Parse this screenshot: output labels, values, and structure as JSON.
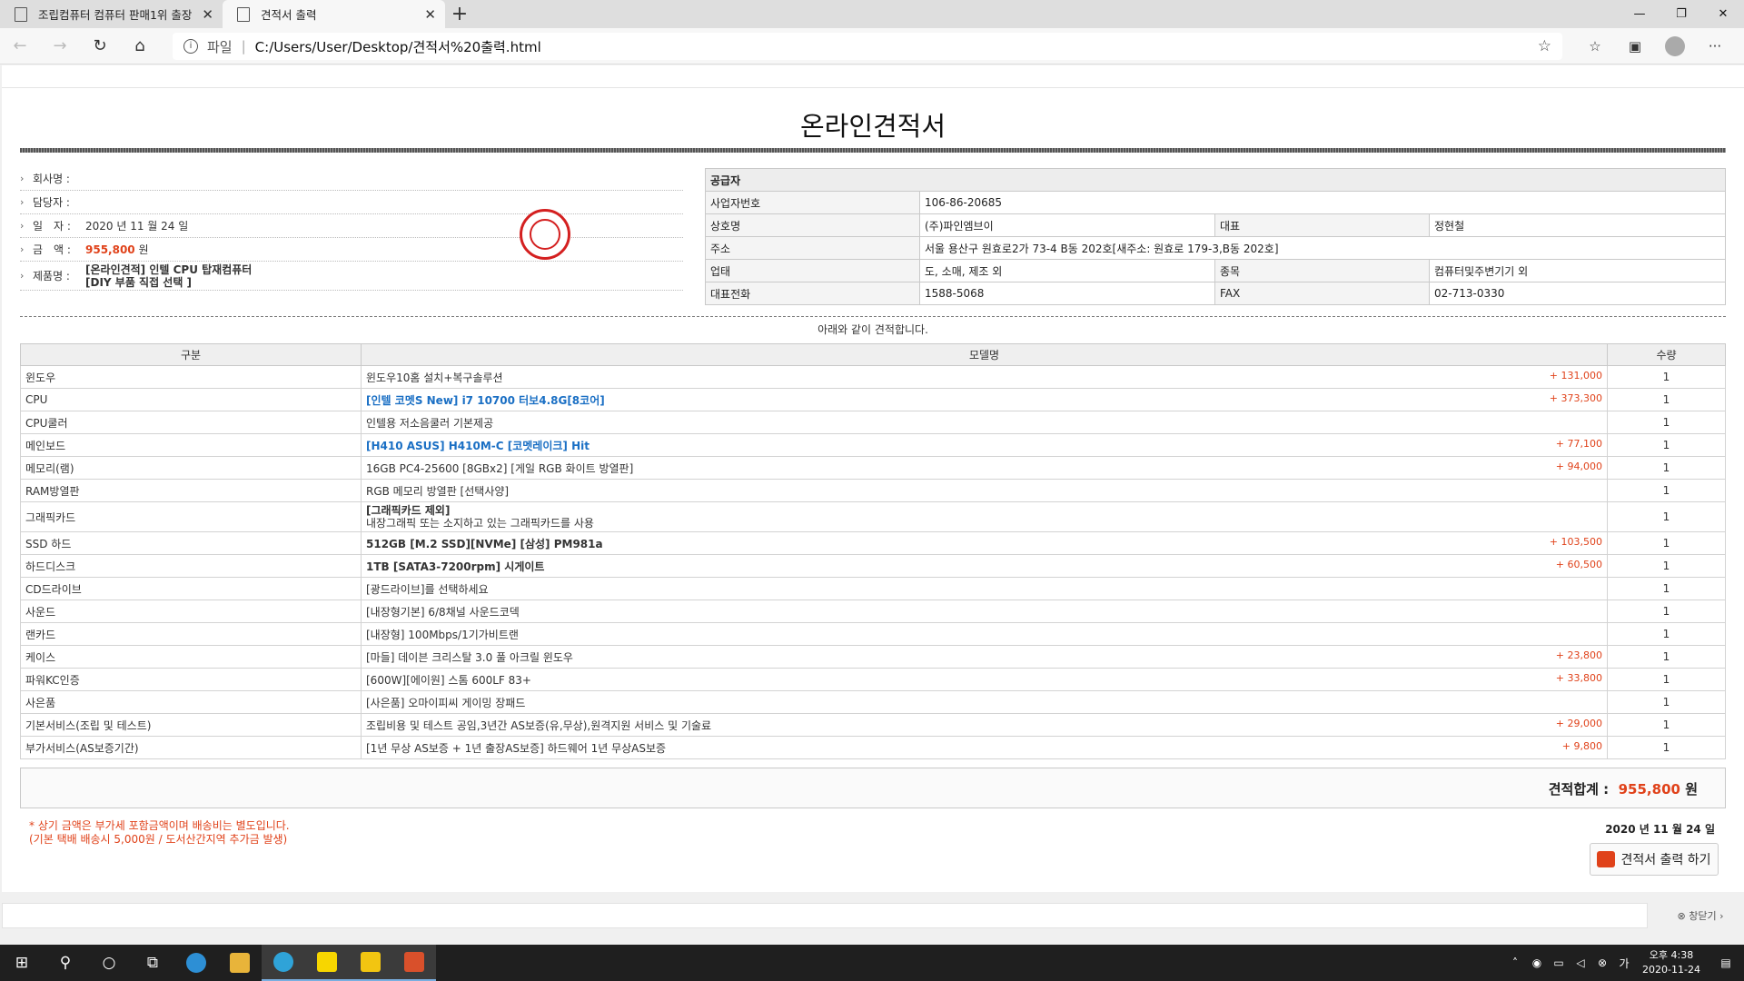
{
  "browser": {
    "tabs": [
      {
        "title": "조립컴퓨터 컴퓨터 판매1위 출장",
        "active": false
      },
      {
        "title": "견적서 출력",
        "active": true
      }
    ],
    "address_proto": "파일",
    "address_url": "C:/Users/User/Desktop/견적서%20출력.html"
  },
  "doc": {
    "title": "온라인견적서",
    "customer": {
      "company_label": "회사명 :",
      "contact_label": "담당자 :",
      "date_label": "일　자 :",
      "date_value": "2020 년 11 월 24 일",
      "amount_label": "금　액 :",
      "amount_value": "955,800",
      "amount_unit": "원",
      "product_label": "제품명 :",
      "product_line1": "[온라인견적] 인텔 CPU 탑재컴퓨터",
      "product_line2": "[DIY 부품 직접 선택 ]"
    },
    "supplier": {
      "header": "공급자",
      "reg_label": "사업자번호",
      "reg_value": "106-86-20685",
      "name_label": "상호명",
      "name_value": "(주)파인엠브이",
      "ceo_label": "대표",
      "ceo_value": "정현철",
      "addr_label": "주소",
      "addr_value": "서울 용산구 원효로2가 73-4 B동 202호[새주소: 원효로 179-3,B동 202호]",
      "biz_label": "업태",
      "biz_value": "도, 소매, 제조 외",
      "type_label": "종목",
      "type_value": "컴퓨터및주변기기 외",
      "tel_label": "대표전화",
      "tel_value": "1588-5068",
      "fax_label": "FAX",
      "fax_value": "02-713-0330"
    },
    "notice": "아래와 같이 견적합니다.",
    "columns": [
      "구분",
      "모델명",
      "수량"
    ],
    "rows": [
      {
        "cat": "윈도우",
        "model": "윈도우10홈 설치+복구솔루션",
        "price": "+ 131,000",
        "qty": "1"
      },
      {
        "cat": "CPU",
        "model": "[인텔 코멧S New] i7 10700 터보4.8G[8코어]",
        "price": "+ 373,300",
        "qty": "1"
      },
      {
        "cat": "CPU쿨러",
        "model": "인텔용 저소음쿨러 기본제공",
        "price": "",
        "qty": "1"
      },
      {
        "cat": "메인보드",
        "model": "[H410 ASUS] H410M-C [코멧레이크] Hit",
        "price": "+ 77,100",
        "qty": "1"
      },
      {
        "cat": "메모리(램)",
        "model": "16GB PC4-25600 [8GBx2] [게일 RGB 화이트 방열판]",
        "price": "+ 94,000",
        "qty": "1"
      },
      {
        "cat": "RAM방열판",
        "model": "RGB 메모리 방열판 [선택사양]",
        "price": "",
        "qty": "1"
      },
      {
        "cat": "그래픽카드",
        "model": "[그래픽카드 제외]",
        "model2": "내장그래픽 또는 소지하고 있는 그래픽카드를 사용",
        "price": "",
        "qty": "1"
      },
      {
        "cat": "SSD 하드",
        "model": "512GB [M.2 SSD][NVMe] [삼성] PM981a",
        "price": "+ 103,500",
        "qty": "1"
      },
      {
        "cat": "하드디스크",
        "model": "1TB [SATA3-7200rpm] 시게이트",
        "price": "+ 60,500",
        "qty": "1"
      },
      {
        "cat": "CD드라이브",
        "model": "[광드라이브]를 선택하세요",
        "price": "",
        "qty": "1"
      },
      {
        "cat": "사운드",
        "model": "[내장형기본] 6/8채널 사운드코덱",
        "price": "",
        "qty": "1"
      },
      {
        "cat": "랜카드",
        "model": "[내장형] 100Mbps/1기가비트랜",
        "price": "",
        "qty": "1"
      },
      {
        "cat": "케이스",
        "model": "[마들] 데이븐 크리스탈 3.0 풀 아크릴 윈도우",
        "price": "+ 23,800",
        "qty": "1"
      },
      {
        "cat": "파워KC인증",
        "model": "[600W][에이원] 스톰 600LF 83+",
        "price": "+ 33,800",
        "qty": "1"
      },
      {
        "cat": "사은품",
        "model": "[사은품] 오마이피씨 게이밍 장패드",
        "price": "",
        "qty": "1"
      },
      {
        "cat": "기본서비스(조립 및 테스트)",
        "model": "조립비용 및 테스트 공임,3년간 AS보증(유,무상),원격지원 서비스 및 기술료",
        "price": "+ 29,000",
        "qty": "1"
      },
      {
        "cat": "부가서비스(AS보증기간)",
        "model": "[1년 무상 AS보증 + 1년 출장AS보증] 하드웨어 1년 무상AS보증",
        "price": "+ 9,800",
        "qty": "1"
      }
    ],
    "total_label": "견적합계 :",
    "total_value": "955,800",
    "total_unit": "원",
    "note1": "* 상기 금액은 부가세 포함금액이며 배송비는 별도입니다.",
    "note2": "(기본 택배 배송시 5,000원 / 도서산간지역 추가금 발생)",
    "footer_date": "2020 년 11 월 24 일",
    "print_button": "견적서 출력 하기",
    "close_label": "창닫기"
  },
  "taskbar": {
    "time": "오후 4:38",
    "date": "2020-11-24"
  }
}
